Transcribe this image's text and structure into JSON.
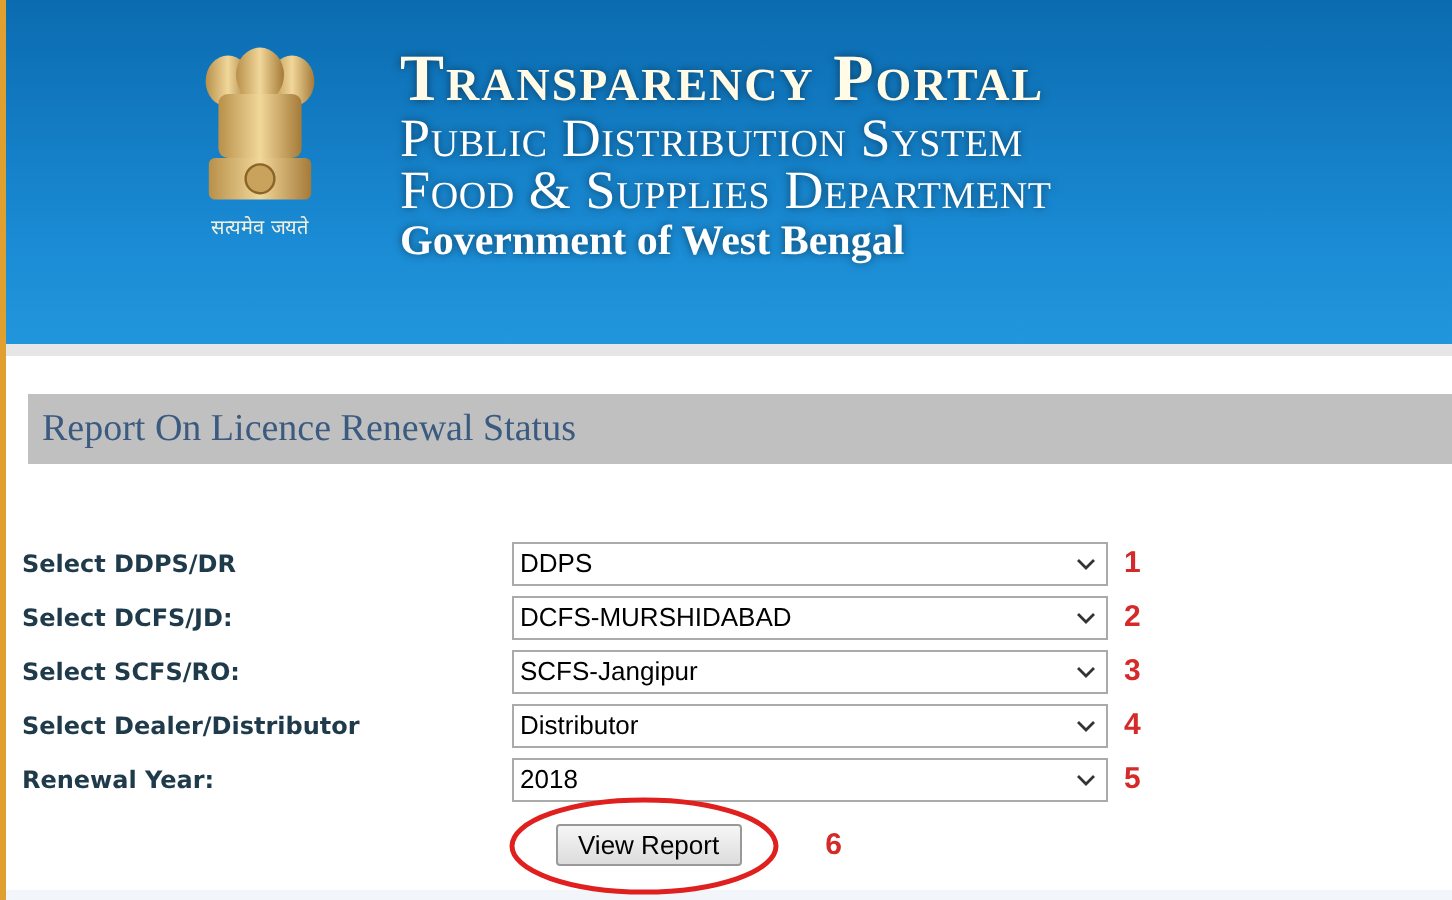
{
  "header": {
    "motto": "सत्यमेव जयते",
    "title": "Transparency Portal",
    "lines": [
      "Public Distribution System",
      "Food & Supplies Department"
    ],
    "subtitle": "Government of West Bengal"
  },
  "report_title": "Report On Licence Renewal Status",
  "fields": [
    {
      "label": "Select DDPS/DR",
      "value": "DDPS",
      "marker": "1"
    },
    {
      "label": "Select DCFS/JD:",
      "value": "DCFS-MURSHIDABAD",
      "marker": "2"
    },
    {
      "label": "Select SCFS/RO:",
      "value": "SCFS-Jangipur",
      "marker": "3"
    },
    {
      "label": "Select Dealer/Distributor",
      "value": "Distributor",
      "marker": "4"
    },
    {
      "label": "Renewal Year:",
      "value": "2018",
      "marker": "5"
    }
  ],
  "button": {
    "label": "View Report",
    "circled": true,
    "marker": "6"
  }
}
